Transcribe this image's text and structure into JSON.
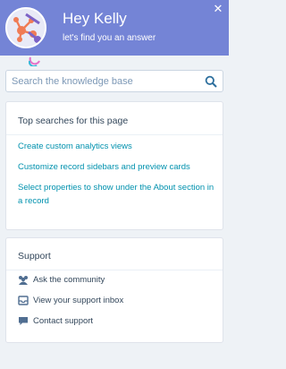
{
  "header": {
    "greeting": "Hey Kelly",
    "subtitle": "let's find you an answer",
    "close_symbol": "✕",
    "background_color": "#7484d6",
    "avatar_icon": "hubspot-sprocket-icon"
  },
  "search": {
    "placeholder": "Search the knowledge base",
    "value": "",
    "icon": "search-icon"
  },
  "top_searches": {
    "title": "Top searches for this page",
    "items": [
      {
        "label": "Create custom analytics views"
      },
      {
        "label": "Customize record sidebars and preview cards"
      },
      {
        "label": "Select properties to show under the About section in a record"
      }
    ]
  },
  "support": {
    "title": "Support",
    "items": [
      {
        "label": "Ask the community",
        "icon": "community-icon"
      },
      {
        "label": "View your support inbox",
        "icon": "inbox-icon"
      },
      {
        "label": "Contact support",
        "icon": "chat-icon"
      }
    ]
  },
  "colors": {
    "link": "#0091ae",
    "text": "#33475b",
    "accent": "#f07b55"
  }
}
